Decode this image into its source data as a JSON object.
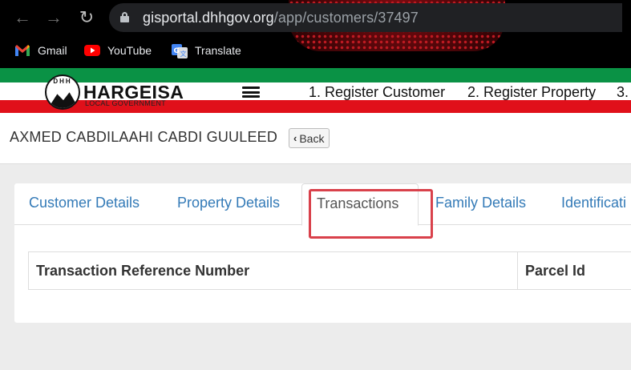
{
  "browser": {
    "url_host": "gisportal.dhhgov.org",
    "url_path": "/app/customers/37497",
    "bookmarks": [
      {
        "label": "Gmail",
        "icon": "gmail-icon"
      },
      {
        "label": "YouTube",
        "icon": "youtube-icon"
      },
      {
        "label": "Translate",
        "icon": "translate-icon"
      }
    ]
  },
  "site": {
    "logo_text": "DHH",
    "brand": "HARGEISA",
    "brand_sub": "LOCAL GOVERNMENT",
    "nav": [
      "1. Register Customer",
      "2. Register Property",
      "3."
    ]
  },
  "page": {
    "title": "AXMED CABDILAAHI CABDI GUULEED",
    "back_label": "Back"
  },
  "tabs": [
    {
      "label": "Customer Details",
      "active": false
    },
    {
      "label": "Property Details",
      "active": false
    },
    {
      "label": "Transactions",
      "active": true
    },
    {
      "label": "Family Details",
      "active": false
    },
    {
      "label": "Identificati",
      "active": false
    }
  ],
  "table": {
    "headers": [
      "Transaction Reference Number",
      "Parcel Id"
    ]
  },
  "colors": {
    "link": "#337ab7",
    "highlight": "#d9414b",
    "flag_green": "#0a9245",
    "flag_red": "#e0101a"
  }
}
